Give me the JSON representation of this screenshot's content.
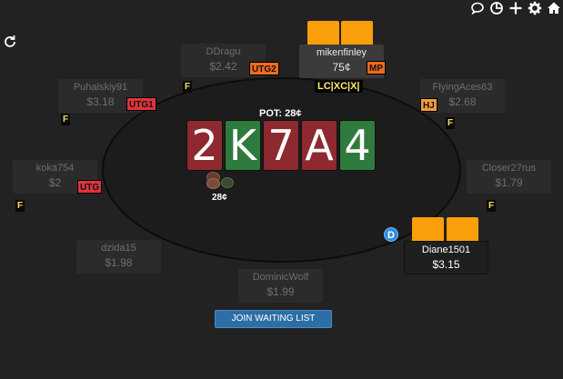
{
  "colors": {
    "accent_blue": "#2e6ea6",
    "card_red": "#8e2a2f",
    "card_green": "#2f7a3d",
    "hole_card_orange": "#fa9e09"
  },
  "icons": [
    "chat-icon",
    "stats-icon",
    "plus-icon",
    "gear-icon",
    "home-icon",
    "refresh-icon"
  ],
  "pot": {
    "label": "POT: 28¢",
    "amount": "28¢"
  },
  "board": {
    "cards": [
      "2",
      "K",
      "7",
      "A",
      "4"
    ]
  },
  "dealer_label": "D",
  "waitlist_label": "JOIN WAITING LIST",
  "seats": {
    "ddragu": {
      "name": "DDragu",
      "stack": "$2.42",
      "position": "UTG2",
      "action": "F"
    },
    "mikenfinley": {
      "name": "mikenfinley",
      "stack": "75¢",
      "position": "MP",
      "action": "LC|XC|X|"
    },
    "puhalskiy": {
      "name": "Puhalskiy91",
      "stack": "$3.18",
      "position": "UTG1",
      "action": "F"
    },
    "flyingaces": {
      "name": "FlyingAces63",
      "stack": "$2.68",
      "position": "HJ",
      "action": "F"
    },
    "koka": {
      "name": "koka754",
      "stack": "$2",
      "position": "UTG",
      "action": "F"
    },
    "closer": {
      "name": "Closer27rus",
      "stack": "$1.79",
      "action": "F"
    },
    "dzida": {
      "name": "dzida15",
      "stack": "$1.98"
    },
    "diane": {
      "name": "Diane1501",
      "stack": "$3.15"
    },
    "dominic": {
      "name": "DominicWolf",
      "stack": "$1.99"
    }
  }
}
